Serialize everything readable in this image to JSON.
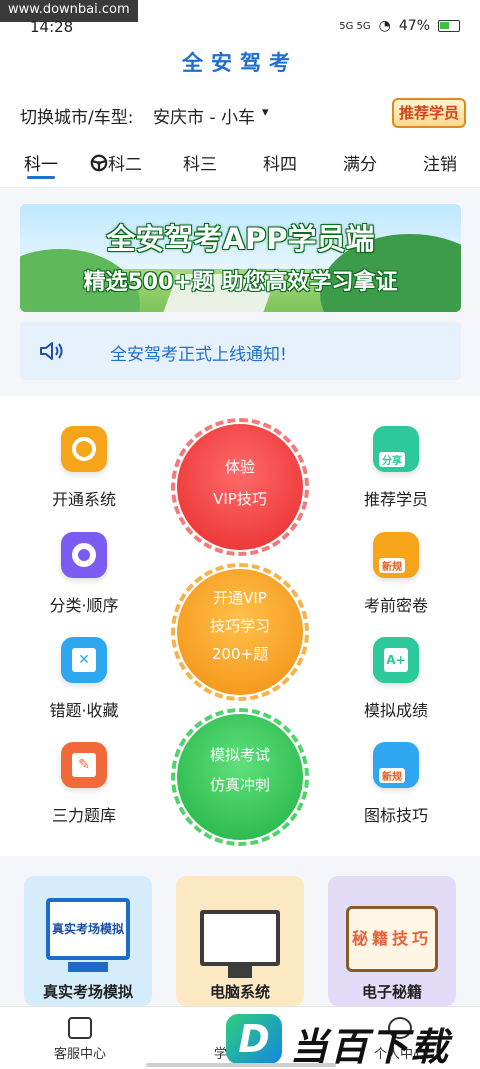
{
  "status_bar": {
    "watermark": "www.downbai.com",
    "time": "14:28",
    "network": "5G  5G",
    "battery_percent": "47%"
  },
  "header": {
    "title": "全安驾考"
  },
  "city_row": {
    "label": "切换城市/车型:",
    "value": "安庆市 - 小车",
    "caret": "▾",
    "badge": "推荐学员"
  },
  "tabs": [
    {
      "label": "科一",
      "active": true
    },
    {
      "label": "科二",
      "active": false
    },
    {
      "label": "科三",
      "active": false
    },
    {
      "label": "科四",
      "active": false
    },
    {
      "label": "满分",
      "active": false
    },
    {
      "label": "注销",
      "active": false
    }
  ],
  "banner": {
    "line1": "全安驾考APP学员端",
    "line2": "精选500+题 助您高效学习拿证"
  },
  "notice": {
    "text": "全安驾考正式上线通知!"
  },
  "left_functions": [
    {
      "label": "开通系统",
      "icon": "share-icon",
      "color": "#f6a41a"
    },
    {
      "label": "分类·顺序",
      "icon": "target-icon",
      "color": "#7a5cf0"
    },
    {
      "label": "错题·收藏",
      "icon": "error-book-icon",
      "color": "#2ea7f0"
    },
    {
      "label": "三力题库",
      "icon": "book-icon",
      "color": "#f26a3a"
    }
  ],
  "right_functions": [
    {
      "label": "推荐学员",
      "icon": "share-doc-icon",
      "color": "#2ec99a",
      "tag": "分享"
    },
    {
      "label": "考前密卷",
      "icon": "calendar-icon",
      "color": "#f6a41a",
      "tag": "新规"
    },
    {
      "label": "模拟成绩",
      "icon": "grade-icon",
      "color": "#2ec99a",
      "tag": ""
    },
    {
      "label": "图标技巧",
      "icon": "cloud-icon",
      "color": "#2ea7f0",
      "tag": "新规"
    }
  ],
  "circles": [
    {
      "line1": "体验",
      "line2": "VIP技巧",
      "line3": "",
      "color": "#f03a3a",
      "ring": "#f06a6a"
    },
    {
      "line1": "开通VIP",
      "line2": "技巧学习",
      "line3": "200+题",
      "color": "#f79a1f",
      "ring": "#f7a83a"
    },
    {
      "line1": "模拟考试",
      "line2": "仿真冲刺",
      "line3": "",
      "color": "#2fc24f",
      "ring": "#47cf5e"
    }
  ],
  "promos": [
    {
      "label": "真实考场模拟",
      "inner": "真实考场模拟",
      "bg": "#d5ecfb"
    },
    {
      "label": "电脑系统",
      "inner": "",
      "bg": "#fde8c4"
    },
    {
      "label": "电子秘籍",
      "inner": "秘籍技巧",
      "bg": "#e3dcf8"
    }
  ],
  "bottom_nav": [
    {
      "label": "客服中心"
    },
    {
      "label": "学习考试"
    },
    {
      "label": "个人中心"
    }
  ],
  "logo_watermark": {
    "mark": "D",
    "text": "当百下载"
  }
}
